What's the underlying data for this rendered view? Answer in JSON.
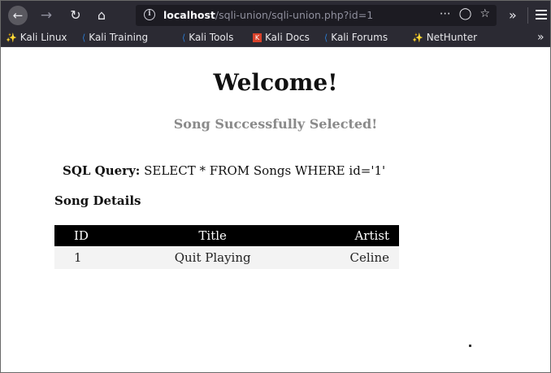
{
  "browser": {
    "nav_icons": {
      "back": "arrow-left-icon",
      "forward": "arrow-right-icon",
      "reload": "reload-icon",
      "home": "home-icon"
    },
    "url": {
      "host": "localhost",
      "path": "/sqli-union/sqli-union.php?id=1"
    },
    "url_actions": [
      "more-icon",
      "pocket-icon",
      "bookmark-star-icon"
    ],
    "bookmarks": [
      "Kali Linux",
      "Kali Training",
      "Kali Tools",
      "Kali Docs",
      "Kali Forums",
      "NetHunter"
    ]
  },
  "page": {
    "heading": "Welcome!",
    "status": "Song Successfully Selected!",
    "query_label": "SQL Query:",
    "query_text": "SELECT * FROM Songs WHERE id='1'",
    "details_heading": "Song Details",
    "table": {
      "headers": [
        "ID",
        "Title",
        "Artist"
      ],
      "rows": [
        [
          "1",
          "Quit Playing",
          "Celine"
        ]
      ]
    }
  },
  "colors": {
    "chrome": "#2b2a33",
    "urlbar": "#1c1b22",
    "table_header": "#000000",
    "status_text": "#8a8a8a"
  }
}
